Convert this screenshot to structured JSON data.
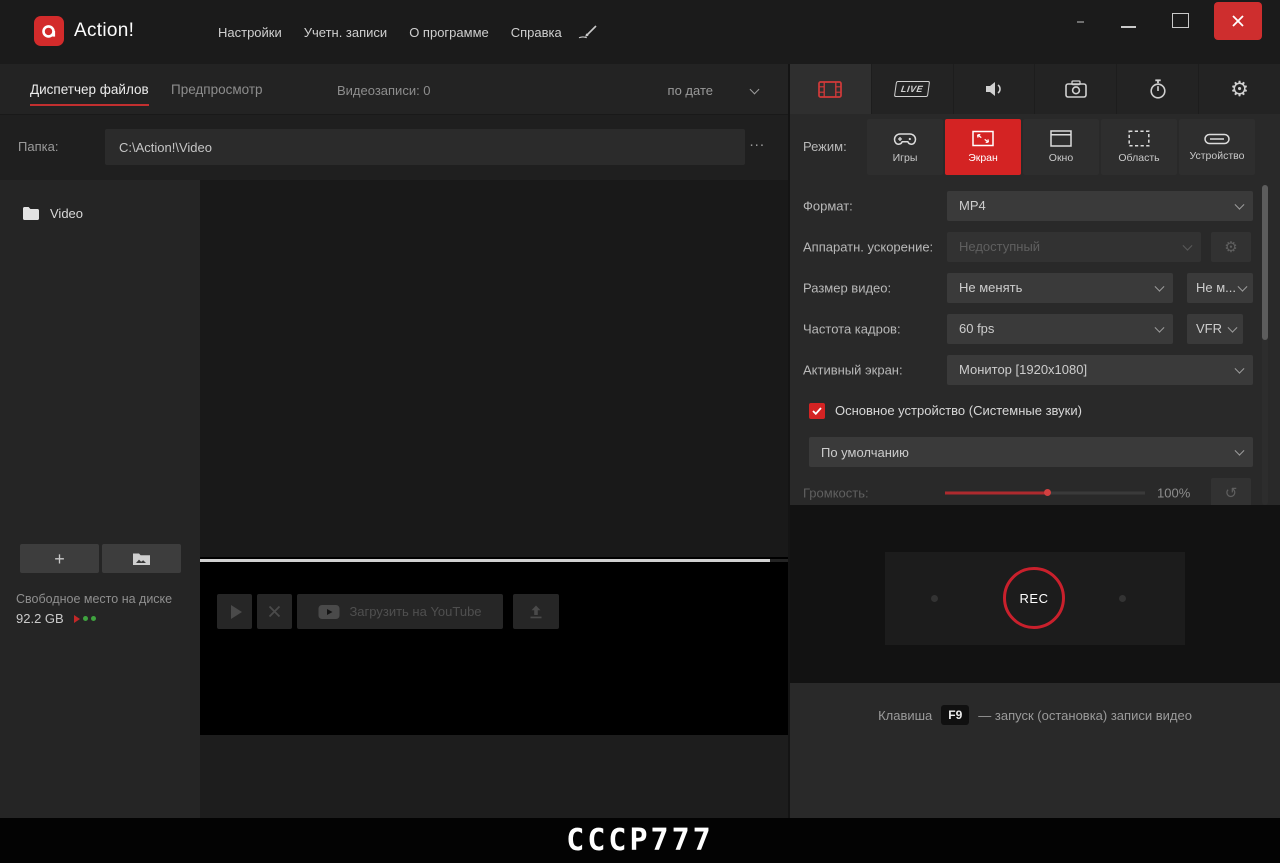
{
  "colors": {
    "accent_red": "#d42323",
    "close_button_red": "#ce2e2e",
    "rec_ring_red": "#c9202c",
    "disk_indicator_green": "#3fa33f"
  },
  "titlebar": {
    "app_name": "Action!",
    "menu": [
      {
        "label": "Настройки"
      },
      {
        "label": "Учетн. записи"
      },
      {
        "label": "О программе"
      },
      {
        "label": "Справка"
      }
    ]
  },
  "file_manager": {
    "tab_file_manager": "Диспетчер файлов",
    "tab_preview": "Предпросмотр",
    "recordings_count_label": "Видеозаписи: 0",
    "sort_by": "по дате",
    "folder_label": "Папка:",
    "folder_path": "C:\\Action!\\Video",
    "browse_button": "...",
    "sidebar_folder": "Video",
    "free_space_label": "Свободное место на диске",
    "free_space_value": "92.2 GB",
    "youtube_upload_button": "Загрузить на YouTube",
    "watermark": "CCCP777"
  },
  "recorder": {
    "mode_label": "Режим:",
    "modes": [
      {
        "label": "Игры"
      },
      {
        "label": "Экран",
        "active": true
      },
      {
        "label": "Окно"
      },
      {
        "label": "Область"
      },
      {
        "label": "Устройство"
      }
    ],
    "rows": [
      {
        "label": "Формат:",
        "value": "MP4"
      },
      {
        "label": "Аппаратн. ускорение:",
        "value": "Недоступный"
      },
      {
        "label": "Размер видео:",
        "value": "Не менять",
        "value2": "Не м..."
      },
      {
        "label": "Частота кадров:",
        "value": "60 fps",
        "value2": "VFR"
      },
      {
        "label": "Активный экран:",
        "value": "Монитор [1920x1080]"
      }
    ],
    "audio_checkbox_label": "Основное устройство (Системные звуки)",
    "audio_device_value": "По умолчанию",
    "volume_label": "Громкость:",
    "volume_value": "100%",
    "rec_button": "REC",
    "hotkey_prefix": "Клавиша",
    "hotkey_key": "F9",
    "hotkey_suffix": "— запуск (остановка) записи видео"
  }
}
